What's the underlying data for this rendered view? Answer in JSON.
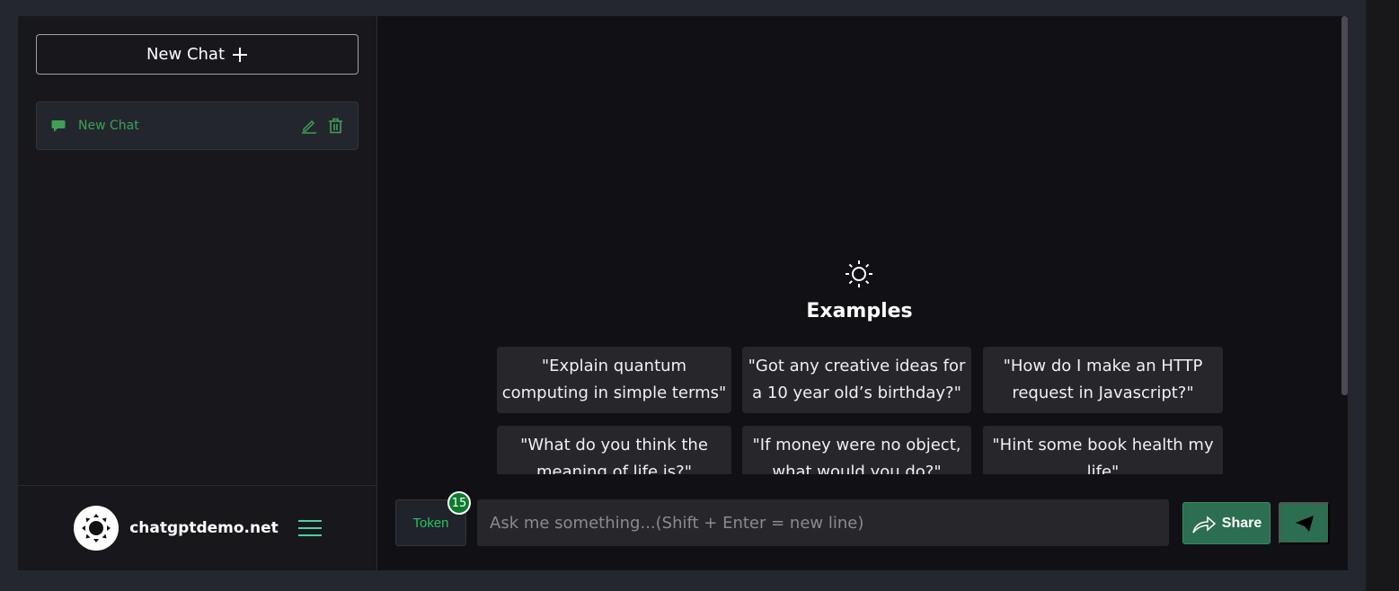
{
  "sidebar": {
    "new_chat_label": "New Chat",
    "chats": [
      {
        "label": "New Chat"
      }
    ],
    "brand": "chatgptdemo.net"
  },
  "examples": {
    "title": "Examples",
    "items": [
      "\"Explain quantum computing in simple terms\"",
      "\"Got any creative ideas for a 10 year old’s birthday?\"",
      "\"How do I make an HTTP request in Javascript?\"",
      "\"What do you think the meaning of life is?\"",
      "\"If money were no object, what would you do?\"",
      "\"Hint some book health my life\""
    ]
  },
  "input": {
    "token_label": "Token",
    "token_count": "15",
    "placeholder": "Ask me something...(Shift + Enter = new line)",
    "value": "",
    "share_label": "Share"
  },
  "colors": {
    "accent": "#2c6e51",
    "chat_green": "#3f9f57",
    "token_green": "#22c55e"
  }
}
